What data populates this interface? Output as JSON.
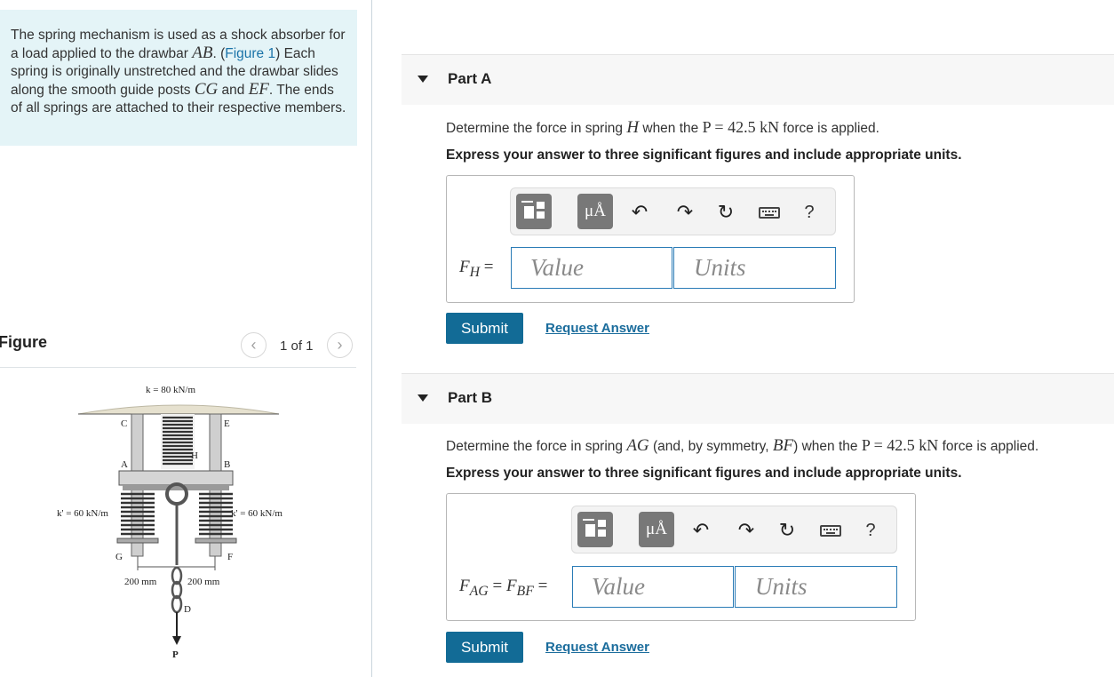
{
  "problem": {
    "text_before_figure_link": "The spring mechanism is used as a shock absorber for a load applied to the drawbar ",
    "text_drawbar_symbol": "AB",
    "text_period": ". (",
    "figure_link": "Figure 1",
    "text_after_link": ") Each spring is originally unstretched and the drawbar slides along the smooth guide posts ",
    "guide_post_1": "CG",
    "and_word": " and ",
    "guide_post_2": "EF",
    "text_end": ". The ends of all springs are attached to their respective members."
  },
  "figure": {
    "title": "Figure",
    "counter": "1 of 1",
    "prev_icon": "chevron-left-icon",
    "next_icon": "chevron-right-icon",
    "labels": {
      "k_top": "k = 80 kN/m",
      "k_left": "k' = 60 kN/m",
      "k_right": "k' = 60 kN/m",
      "C": "C",
      "E": "E",
      "A": "A",
      "B": "B",
      "H": "H",
      "G": "G",
      "F": "F",
      "D": "D",
      "P": "P",
      "dim_left": "200 mm",
      "dim_right": "200 mm"
    }
  },
  "partA": {
    "title": "Part A",
    "question_1": "Determine the force in spring ",
    "question_sym": "H",
    "question_2": " when the ",
    "question_math": "P = 42.5 kN",
    "question_3": " force is applied.",
    "instruction": "Express your answer to three significant figures and include appropriate units.",
    "answer_label": "F",
    "answer_sub": "H",
    "equals": "=",
    "value_placeholder": "Value",
    "units_placeholder": "Units",
    "submit": "Submit",
    "request": "Request Answer"
  },
  "partB": {
    "title": "Part B",
    "question_1": "Determine the force in spring ",
    "question_sym1": "AG",
    "question_2": " (and, by symmetry, ",
    "question_sym2": "BF",
    "question_3": ") when the ",
    "question_math": "P = 42.5 kN",
    "question_4": " force is applied.",
    "instruction": "Express your answer to three significant figures and include appropriate units.",
    "answer_label_1": "F",
    "answer_sub_1": "AG",
    "equals_mid": "=",
    "answer_label_2": "F",
    "answer_sub_2": "BF",
    "equals": "=",
    "value_placeholder": "Value",
    "units_placeholder": "Units",
    "submit": "Submit",
    "request": "Request Answer"
  },
  "toolbar": {
    "units_button": "μÅ",
    "help": "?",
    "icons": [
      "templates-icon",
      "units-icon",
      "undo-icon",
      "redo-icon",
      "reset-icon",
      "keyboard-icon",
      "help-icon"
    ]
  }
}
